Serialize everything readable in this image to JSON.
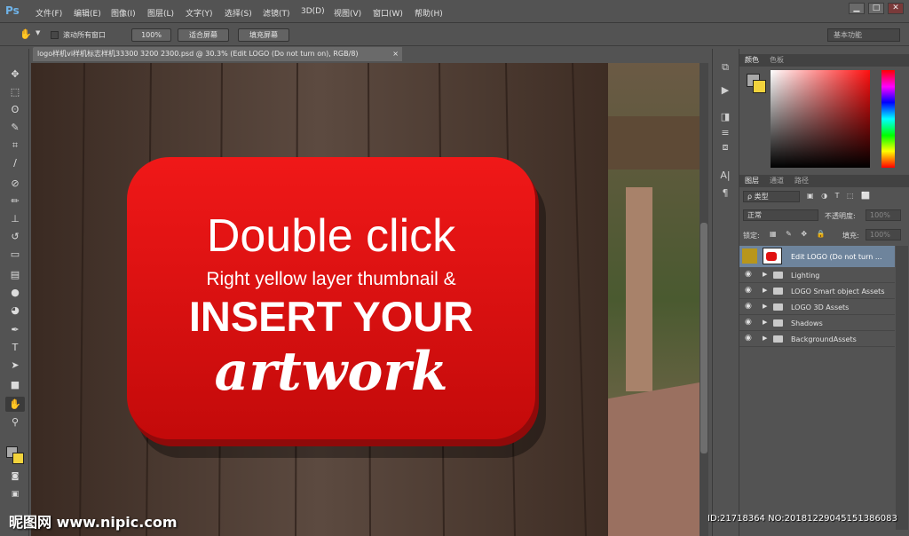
{
  "app": {
    "logo": "Ps"
  },
  "menu": [
    "文件(F)",
    "编辑(E)",
    "图像(I)",
    "图层(L)",
    "文字(Y)",
    "选择(S)",
    "滤镜(T)",
    "3D(D)",
    "视图(V)",
    "窗口(W)",
    "帮助(H)"
  ],
  "window_controls": {
    "minimize": "▁",
    "maximize": "□",
    "close": "✕"
  },
  "options": {
    "hand": "✋",
    "scroll_all": "滚动所有窗口",
    "zoom100": "100%",
    "fit_screen": "适合屏幕",
    "fill_screen": "填充屏幕",
    "workspace": "基本功能"
  },
  "document": {
    "tab_title": "logo样机vi样机标志样机33300 3200 2300.psd @ 30.3% (Edit LOGO (Do not turn on), RGB/8)",
    "close": "×"
  },
  "sign": {
    "line1": "Double click",
    "line2": "Right yellow layer thumbnail &",
    "line3": "INSERT YOUR",
    "line4": "artwork"
  },
  "color_panel": {
    "tab_color": "颜色",
    "tab_swatches": "色板",
    "fg": "#a8a8a8",
    "bg": "#f2d33c"
  },
  "layers_panel": {
    "tab_layers": "图层",
    "tab_channels": "通道",
    "tab_paths": "路径",
    "filter": "ρ 类型",
    "blend_mode": "正常",
    "opacity_label": "不透明度:",
    "opacity": "100%",
    "lock_label": "锁定:",
    "fill_label": "填充:",
    "fill": "100%",
    "selected_layer": "Edit LOGO (Do not turn ...",
    "groups": [
      "Lighting",
      "LOGO Smart object Assets",
      "LOGO 3D Assets",
      "Shadows",
      "BackgroundAssets"
    ]
  },
  "watermark": {
    "text": "昵图网 www.nipic.com",
    "id_line": "ID:21718364 NO:20181229045151386083"
  }
}
